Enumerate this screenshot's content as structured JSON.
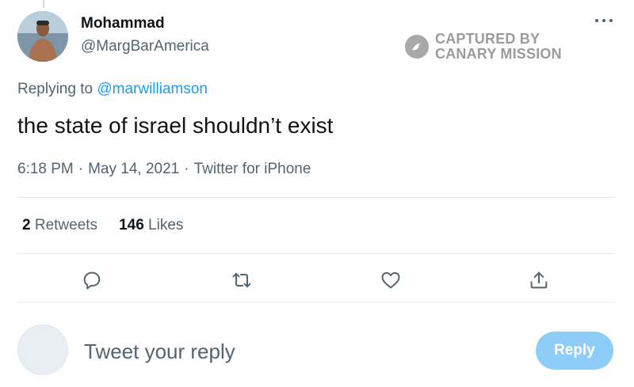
{
  "author": {
    "display_name": "Mohammad",
    "handle": "@MargBarAmerica"
  },
  "watermark": {
    "line1": "CAPTURED BY",
    "line2": "CANARY MISSION",
    "icon": "canary-bird-icon"
  },
  "reply_context": {
    "prefix": "Replying to",
    "mention": "@marwilliamson"
  },
  "tweet": {
    "text": "the state of israel shouldn’t exist",
    "time": "6:18 PM",
    "separator": "·",
    "date": "May 14, 2021",
    "source": "Twitter for iPhone"
  },
  "stats": {
    "retweets_count": "2",
    "retweets_label": "Retweets",
    "likes_count": "146",
    "likes_label": "Likes"
  },
  "actions": {
    "icons": [
      "reply-icon",
      "retweet-icon",
      "like-icon",
      "share-icon"
    ],
    "color": "#536471"
  },
  "compose": {
    "placeholder": "Tweet your reply",
    "button_label": "Reply"
  },
  "colors": {
    "accent": "#1d9bf0",
    "reply_button": "#8ecdf7",
    "text_primary": "#0f1419",
    "text_secondary": "#536471"
  }
}
